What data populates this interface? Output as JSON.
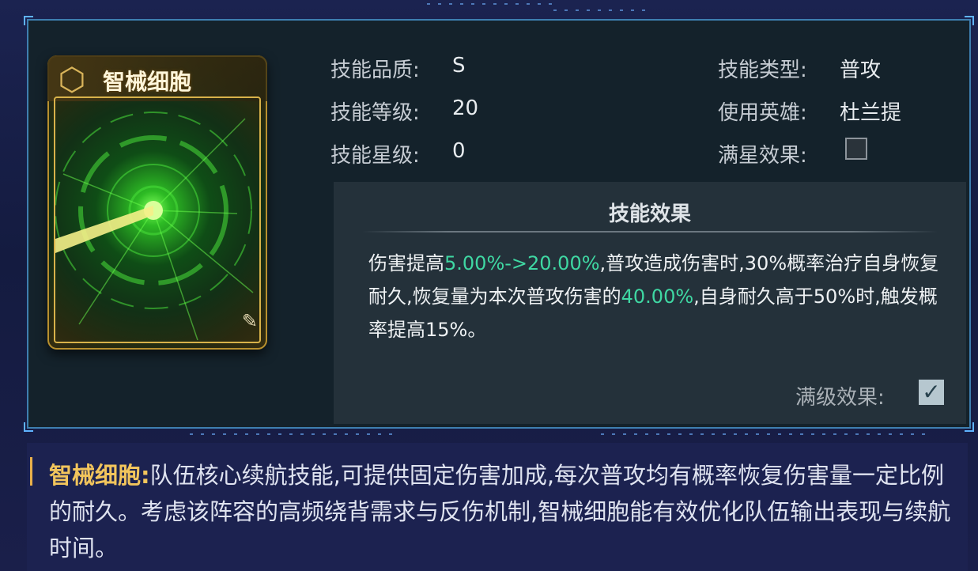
{
  "card": {
    "title": "智械细胞",
    "emblem_icon": "skill-emblem-icon",
    "edit_icon": "pen-icon"
  },
  "info": {
    "quality_label": "技能品质:",
    "quality_value": "S",
    "level_label": "技能等级:",
    "level_value": "20",
    "star_label": "技能星级:",
    "star_value": "0",
    "type_label": "技能类型:",
    "type_value": "普攻",
    "hero_label": "使用英雄:",
    "hero_value": "杜兰提",
    "full_star_label": "满星效果:",
    "full_star_checked": false
  },
  "effect": {
    "title": "技能效果",
    "text_1": "伤害提高",
    "highlight_1": "5.00%->20.00%",
    "text_2": ",普攻造成伤害时,30%概率治疗自身恢复耐久,恢复量为本次普攻伤害的",
    "highlight_2": "40.00%",
    "text_3": ",自身耐久高于50%时,触发概率提高15%。",
    "max_level_label": "满级效果:",
    "max_level_checked": true
  },
  "description": {
    "name": "智械细胞:",
    "body": "队伍核心续航技能,可提供固定伤害加成,每次普攻均有概率恢复伤害量一定比例的耐久。考虑该阵容的高频绕背需求与反伤机制,智械细胞能有效优化队伍输出表现与续航时间。"
  },
  "colors": {
    "highlight": "#3fd8a3",
    "name_gold": "#f2c55c",
    "frame_blue": "#3e7fb0"
  }
}
